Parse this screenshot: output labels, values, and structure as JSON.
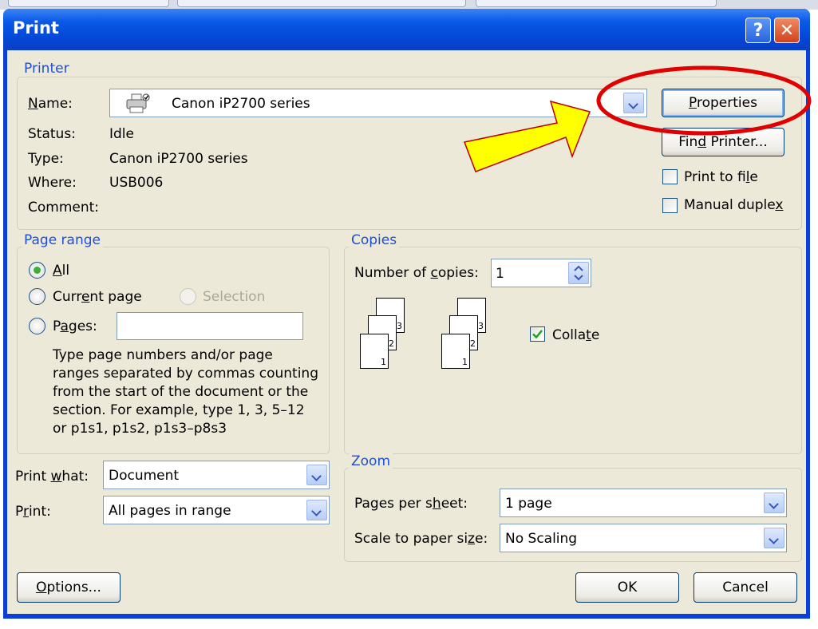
{
  "window": {
    "title": "Print"
  },
  "printer": {
    "group_label": "Printer",
    "name_label": "Name:",
    "name_value": "Canon iP2700 series",
    "status_label": "Status:",
    "status_value": "Idle",
    "type_label": "Type:",
    "type_value": "Canon iP2700 series",
    "where_label": "Where:",
    "where_value": "USB006",
    "comment_label": "Comment:",
    "comment_value": "",
    "properties_button": "Properties",
    "find_printer_button": "Find Printer...",
    "print_to_file_label": "Print to file",
    "print_to_file_checked": false,
    "manual_duplex_label": "Manual duplex",
    "manual_duplex_checked": false
  },
  "page_range": {
    "group_label": "Page range",
    "all_label": "All",
    "current_page_label": "Current page",
    "selection_label": "Selection",
    "pages_label": "Pages:",
    "pages_value": "",
    "selected": "All",
    "help_lines": [
      "Type page numbers and/or page",
      "ranges separated by commas counting",
      "from the start of the document or the",
      "section. For example, type 1, 3, 5–12",
      "or p1s1, p1s2, p1s3–p8s3"
    ]
  },
  "copies": {
    "group_label": "Copies",
    "number_label": "Number of copies:",
    "number_value": "1",
    "collate_label": "Collate",
    "collate_checked": true,
    "page_numbers": [
      "3",
      "2",
      "1"
    ]
  },
  "print_what": {
    "label": "Print what:",
    "value": "Document"
  },
  "print": {
    "label": "Print:",
    "value": "All pages in range"
  },
  "zoom": {
    "group_label": "Zoom",
    "pages_per_sheet_label": "Pages per sheet:",
    "pages_per_sheet_value": "1 page",
    "scale_label": "Scale to paper size:",
    "scale_value": "No Scaling"
  },
  "buttons": {
    "options": "Options...",
    "ok": "OK",
    "cancel": "Cancel"
  },
  "annotations": {
    "arrow_color": "#ffff00",
    "circle_color": "#e00000"
  },
  "colors": {
    "titlebar": "#0a5ae8",
    "dialog_bg": "#ece9d8",
    "group_label": "#1f4fd3"
  }
}
